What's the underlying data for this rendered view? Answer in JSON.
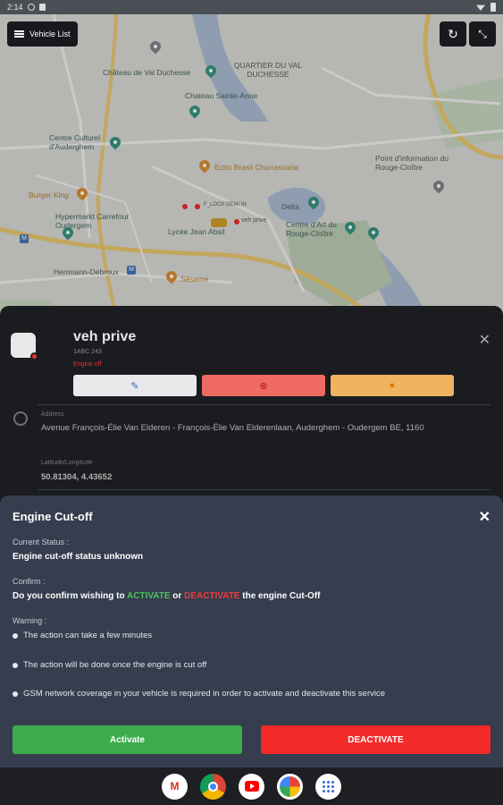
{
  "status_bar": {
    "time": "2:14"
  },
  "map_toolbar": {
    "list_button": "Vehicle List"
  },
  "map_labels": [
    {
      "text": "Château de Val Duchesse"
    },
    {
      "text": "QUARTIER DU VAL DUCHESSE"
    },
    {
      "text": "Chateau Sainte-Anne"
    },
    {
      "text": "Centre Culturel d'Auderghem"
    },
    {
      "text": "Echo Brasil Churrascaria"
    },
    {
      "text": "Point d'information du Rouge-Cloître"
    },
    {
      "text": "Burger King"
    },
    {
      "text": "Hypermarkt Carrefour Oudergem"
    },
    {
      "text": "Lycée Jean Absil"
    },
    {
      "text": "Centre d'Art du Rouge-Cloître"
    },
    {
      "text": "Herrmann-Debroux"
    },
    {
      "text": "Sésame"
    },
    {
      "text": "Delta"
    },
    {
      "text": "F_LOCK DEMI IN"
    },
    {
      "text": "veh prive"
    }
  ],
  "vehicle": {
    "name": "veh prive",
    "plate": "1ABC 243",
    "engine_status": "Engine off",
    "address_label": "Address",
    "address": "Avenue François-Élie Van Elderen - François-Élie Van Elderenlaan, Auderghem - Oudergem BE, 1160",
    "coords_label": "Latitude/Longitude",
    "coords": "50.81304, 4.43652"
  },
  "modal": {
    "title": "Engine Cut-off",
    "current_status_label": "Current Status :",
    "current_status_value": "Engine cut-off status unknown",
    "confirm_label": "Confirm :",
    "confirm_prefix": "Do you confirm wishing to",
    "confirm_activate": "ACTIVATE",
    "confirm_or": "or",
    "confirm_deactivate": "DEACTIVATE",
    "confirm_suffix": "the engine Cut-Off",
    "warning_label": "Warning :",
    "warnings": [
      "The action can take a few minutes",
      "The action will be done once the engine is cut off",
      "GSM network coverage in your vehicle is required in order to activate and deactivate this service"
    ],
    "activate_button": "Activate",
    "deactivate_button": "DEACTIVATE"
  },
  "nav_apps": [
    "Gmail",
    "Chrome",
    "YouTube",
    "Photos",
    "Apps"
  ]
}
